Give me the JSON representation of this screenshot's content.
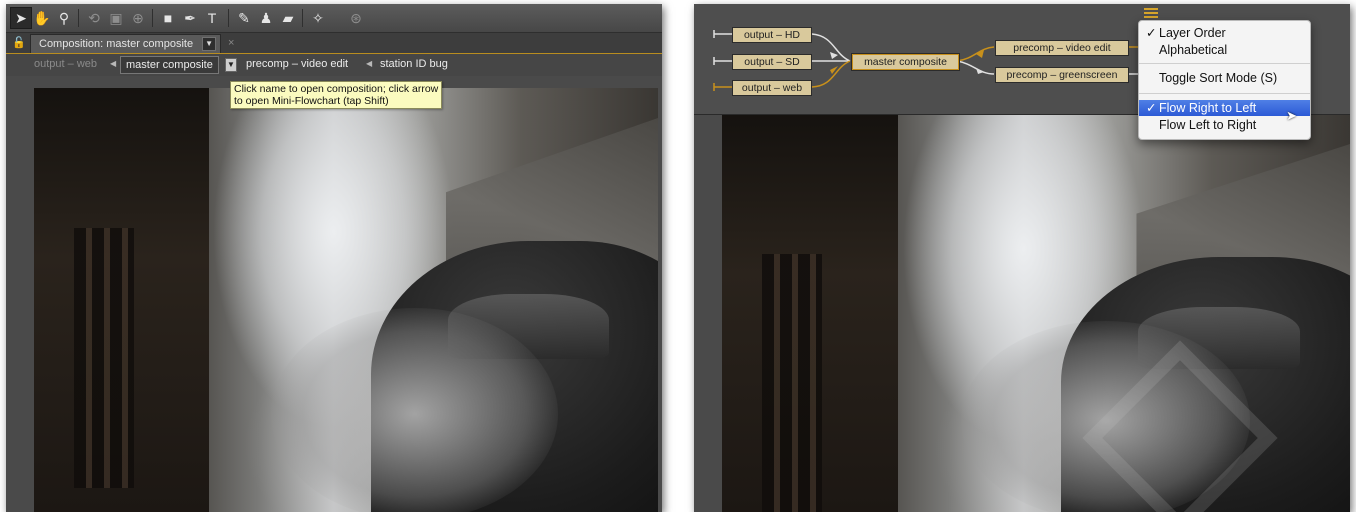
{
  "left": {
    "comp_tab_label": "Composition: master composite",
    "breadcrumbs": [
      {
        "label": "output – web",
        "state": "dim"
      },
      {
        "label": "master composite",
        "state": "current"
      },
      {
        "label": "precomp – video edit",
        "state": "normal"
      },
      {
        "label": "station ID bug",
        "state": "normal"
      }
    ],
    "tooltip_line1": "Click name to open composition; click arrow",
    "tooltip_line2": "to open Mini-Flowchart (tap Shift)",
    "toolbar_icons": [
      "selection-tool-icon",
      "hand-tool-icon",
      "zoom-tool-icon",
      "rotate-tool-icon",
      "camera-tool-icon",
      "pan-behind-tool-icon",
      "rectangle-tool-icon",
      "pen-tool-icon",
      "type-tool-icon",
      "brush-tool-icon",
      "clone-stamp-tool-icon",
      "eraser-tool-icon",
      "roto-brush-tool-icon",
      "puppet-pin-tool-icon"
    ]
  },
  "right": {
    "flow_nodes": {
      "out_hd": "output – HD",
      "out_sd": "output – SD",
      "out_web": "output – web",
      "center": "master composite",
      "video_edit": "precomp – video edit",
      "greenscreen": "precomp – greenscreen"
    },
    "menu": {
      "layer_order": "Layer Order",
      "alphabetical": "Alphabetical",
      "toggle_sort": "Toggle Sort Mode  (S)",
      "flow_rtl": "Flow Right to Left",
      "flow_ltr": "Flow Left to Right",
      "check": "✓"
    }
  },
  "colors": {
    "accent_orange": "#c8901b",
    "node_fill": "#d9c99c",
    "menu_highlight": "#3b6ce0",
    "tooltip_bg": "#fbfbbf"
  }
}
